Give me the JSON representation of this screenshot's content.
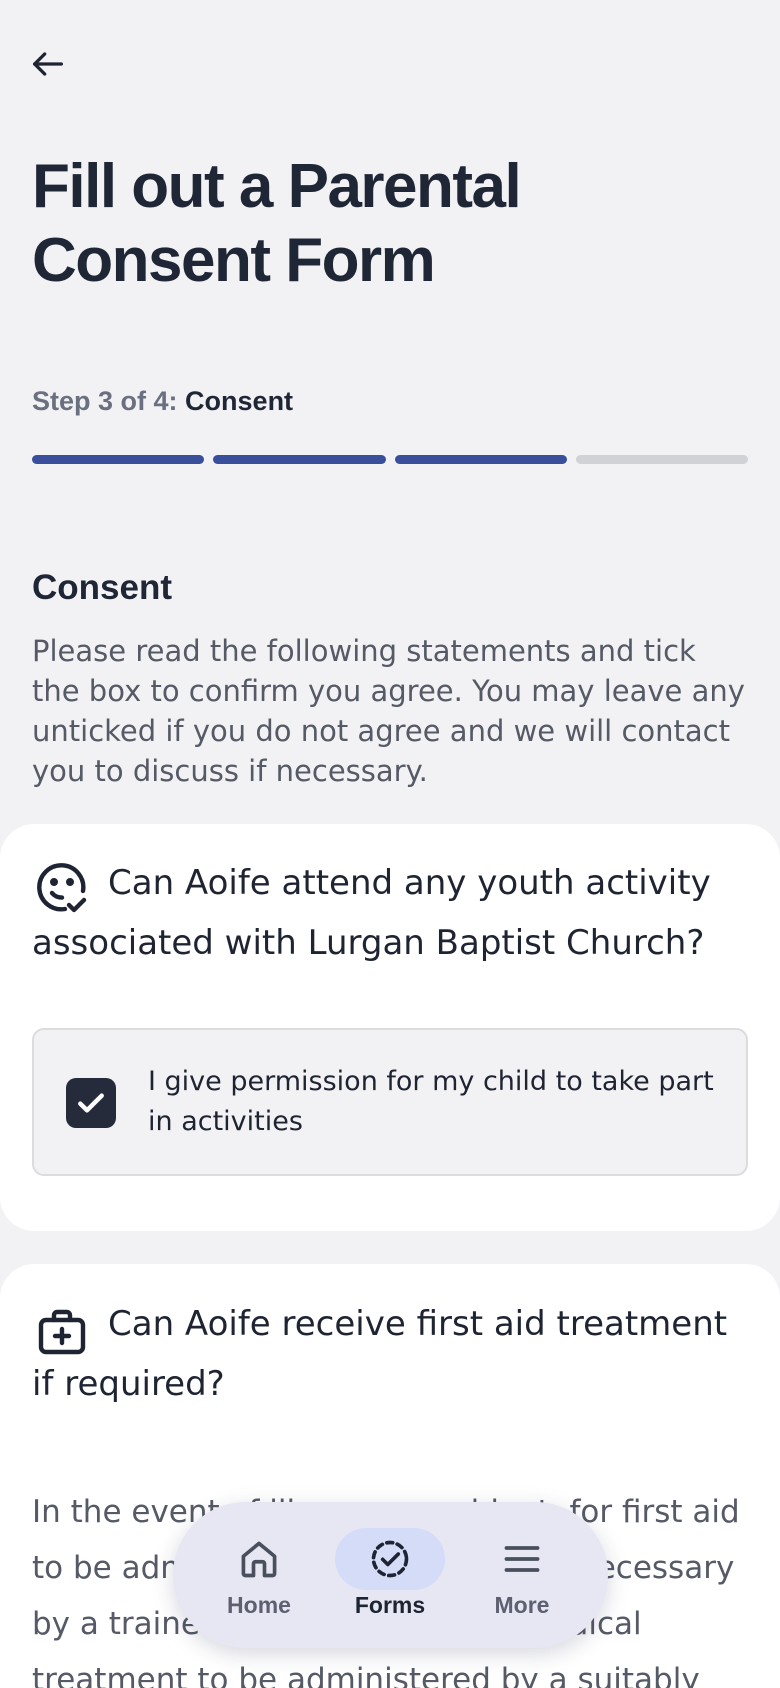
{
  "header": {
    "title": "Fill out a Parental Consent Form"
  },
  "progress": {
    "step_prefix": "Step 3 of 4:",
    "step_name": "Consent",
    "current_step": 3,
    "total_steps": 4
  },
  "section": {
    "title": "Consent",
    "description": "Please read the following statements and tick the box to confirm you agree. You may leave any unticked if you do not agree and we will contact you to discuss if necessary."
  },
  "questions": [
    {
      "icon": "smiley-check-icon",
      "text": "Can Aoife attend any youth activity associated with Lurgan Baptist Church?",
      "consent_label": "I give permission for my child to take part in activities",
      "checked": true
    },
    {
      "icon": "first-aid-kit-icon",
      "text": "Can Aoife receive first aid treatment if required?",
      "body": "In the event of illness or accident, for first aid to be administered where deemed necessary by a trained first aider, and for medical treatment to be administered by a suitably"
    }
  ],
  "nav": {
    "items": [
      {
        "label": "Home",
        "icon": "home-icon",
        "active": false
      },
      {
        "label": "Forms",
        "icon": "forms-check-icon",
        "active": true
      },
      {
        "label": "More",
        "icon": "menu-icon",
        "active": false
      }
    ]
  },
  "colors": {
    "background": "#f2f2f4",
    "accent": "#3a4f9c",
    "text_dark": "#1f2635",
    "nav_bg": "#e6e7f3",
    "nav_active": "#d4dcf8"
  }
}
